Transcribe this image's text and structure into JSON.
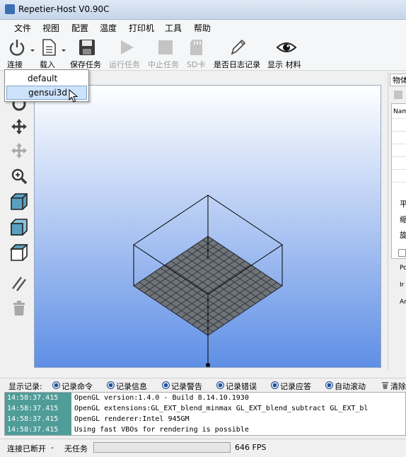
{
  "window": {
    "title": "Repetier-Host V0.90C"
  },
  "menu": [
    "文件",
    "视图",
    "配置",
    "温度",
    "打印机",
    "工具",
    "帮助"
  ],
  "toolbar": {
    "connect": "连接",
    "load": "载入",
    "save_job": "保存任务",
    "run_job": "运行任务",
    "stop_job": "中止任务",
    "sd_card": "SD卡",
    "log_toggle": "是否日志记录",
    "show_filament": "显示 材料"
  },
  "connect_dropdown": {
    "options": [
      "default",
      "gensui3d"
    ],
    "highlighted": "gensui3d"
  },
  "right_panel": {
    "tab": "物体",
    "grid_header": "Nam",
    "labels": [
      "平",
      "缩",
      "旋",
      "Po",
      "Ir",
      "Ar"
    ]
  },
  "log_filters": {
    "label": "显示记录:",
    "items": [
      "记录命令",
      "记录信息",
      "记录警告",
      "记录错误",
      "记录应答",
      "自动滚动"
    ],
    "clear": "清除"
  },
  "log": [
    {
      "time": "14:58:37.415",
      "msg": "OpenGL version:1.4.0 - Build 8.14.10.1930"
    },
    {
      "time": "14:58:37.415",
      "msg": "OpenGL extensions:GL_EXT_blend_minmax GL_EXT_blend_subtract GL_EXT_bl"
    },
    {
      "time": "14:58:37.415",
      "msg": "OpenGL renderer:Intel 945GM"
    },
    {
      "time": "14:58:37.415",
      "msg": "Using fast VBOs for rendering is possible"
    }
  ],
  "status": {
    "connection": "连接已断开",
    "sep": "-",
    "job": "无任务",
    "progress": 0,
    "fps": "646 FPS"
  },
  "colors": {
    "viewport_top": "#ffffff",
    "viewport_bottom": "#5f8fe6",
    "log_time_bg": "#4f9c98",
    "bed": "#6e7379"
  }
}
